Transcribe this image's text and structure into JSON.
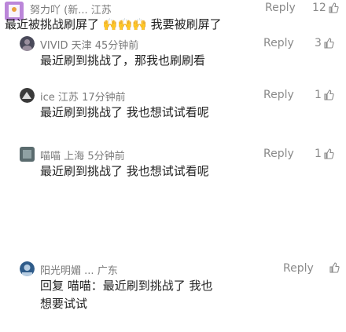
{
  "comments": [
    {
      "author": "努力吖",
      "tag": "(新...",
      "region": "江苏",
      "time": "",
      "reply_label": "Reply",
      "likes": "12",
      "text_lines": [
        "最近被挑战刷屏了",
        ""
      ],
      "text_emojis": "🙌🙌🙌",
      "text_tail": "我要被刷屏了"
    },
    {
      "author": "VIVID",
      "tag": "天津",
      "region": "",
      "time": "45分钟前",
      "reply_label": "Reply",
      "likes": "3",
      "text_lines": [
        "最近刷到挑战了，那我也刷刷看"
      ]
    },
    {
      "author": "ice",
      "tag": "江苏",
      "region": "",
      "time": "17分钟前",
      "reply_label": "Reply",
      "likes": "1",
      "text_lines": [
        "最近刷到挑战了 我也想试试看呢"
      ]
    },
    {
      "author": "喵喵",
      "tag": "上海",
      "region": "",
      "time": "5分钟前",
      "reply_label": "Reply",
      "likes": "1",
      "text_lines": [
        "最近刷到挑战了 我也想试试看呢"
      ]
    },
    {
      "author": "阳光明媚",
      "tag": "...",
      "region": "广东",
      "time": "",
      "reply_label": "Reply",
      "likes": "",
      "text_lines": [
        "回复 喵喵：最近刷到挑战了 我也",
        "想要试试"
      ]
    }
  ]
}
